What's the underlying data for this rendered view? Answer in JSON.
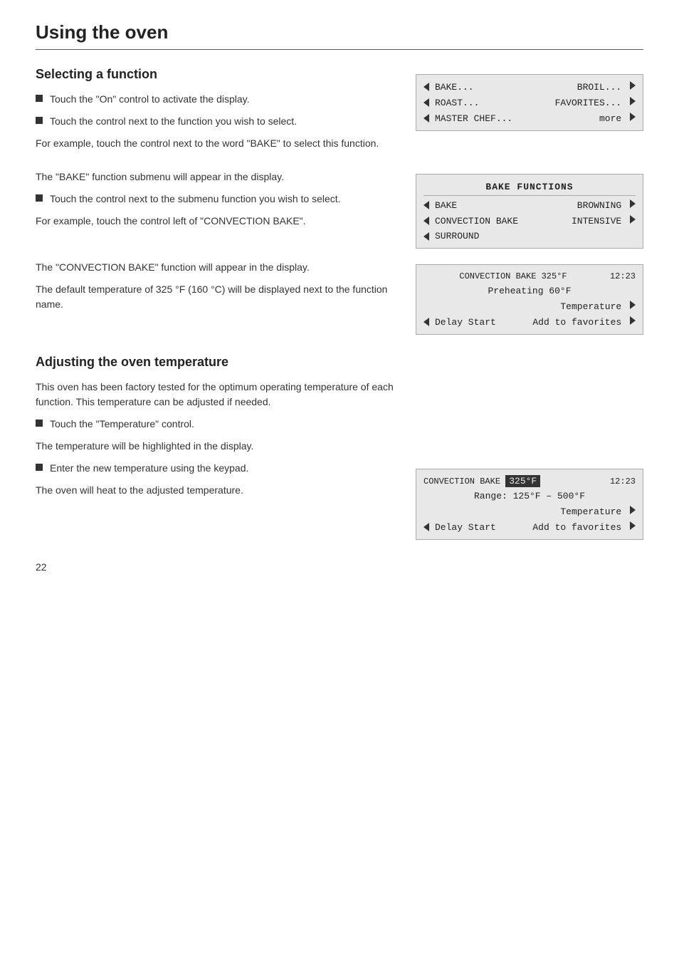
{
  "page": {
    "title": "Using the oven",
    "page_number": "22"
  },
  "section1": {
    "title": "Selecting a function",
    "bullets": [
      "Touch the \"On\" control to activate the display.",
      "Touch the control next to the function you wish to select."
    ],
    "text1": "For example, touch the control next to the word \"BAKE\" to select this function.",
    "text2": "The \"BAKE\" function submenu will appear in the display.",
    "bullet2": "Touch the control next to the submenu function you wish to select.",
    "text3": "For example, touch the control left of \"CONVECTION BAKE\".",
    "text4": "The \"CONVECTION BAKE\" function will appear in the display.",
    "text5": "The default temperature of 325 °F (160 °C) will be displayed next to the function name."
  },
  "section2": {
    "title": "Adjusting the oven temperature",
    "text1": "This oven has been factory tested for the optimum operating temperature of each function. This temperature can be adjusted if needed.",
    "bullet1": "Touch the \"Temperature\" control.",
    "text2": "The temperature will be highlighted in the display.",
    "bullet2": "Enter the new temperature using the keypad.",
    "text3": "The oven will heat to the adjusted temperature."
  },
  "display1": {
    "rows": [
      {
        "left": "BAKE...",
        "right": "BROIL... ▶"
      },
      {
        "left": "ROAST...",
        "right": "FAVORITES... ▶"
      },
      {
        "left": "MASTER CHEF...",
        "right": "more ▶"
      }
    ]
  },
  "display2": {
    "header": "BAKE FUNCTIONS",
    "rows": [
      {
        "left": "BAKE",
        "right": "BROWNING ▶"
      },
      {
        "left": "CONVECTION BAKE",
        "right": "INTENSIVE ▶"
      },
      {
        "left": "SURROUND",
        "right": ""
      }
    ]
  },
  "display3": {
    "line1_left": "CONVECTION BAKE 325°F",
    "line1_right": "12:23",
    "line2": "Preheating 60°F",
    "line3_right": "Temperature ▶",
    "line4_left": "◀ Delay Start",
    "line4_right": "Add to favorites ▶"
  },
  "display4": {
    "line1_left": "CONVECTION BAKE",
    "line1_temp": "325°F",
    "line1_right": "12:23",
    "line2": "Range: 125°F – 500°F",
    "line3_right": "Temperature ▶",
    "line4_left": "◀ Delay Start",
    "line4_right": "Add to favorites ▶"
  }
}
